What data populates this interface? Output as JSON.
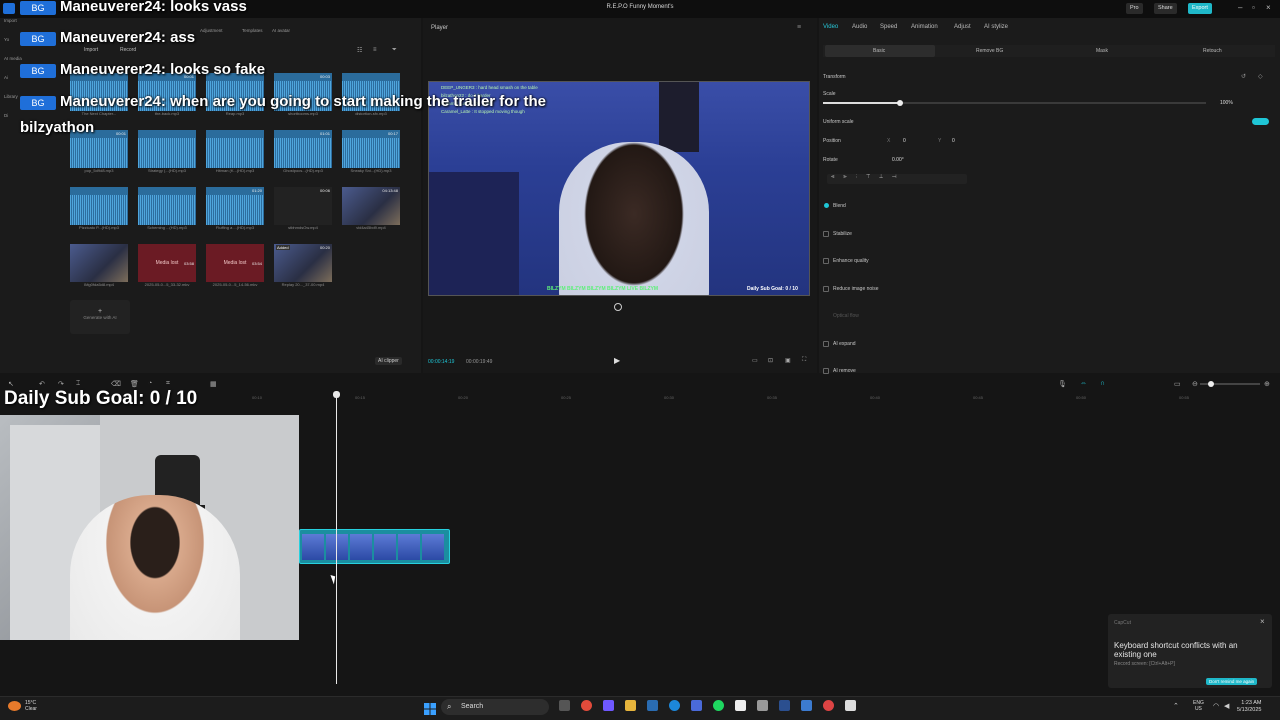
{
  "window": {
    "title": "R.E.P.O Funny Moment's",
    "pro_label": "Pro",
    "share_label": "Share",
    "export_label": "Export"
  },
  "chat_overlay": [
    {
      "user": "Maneuverer24",
      "message": ": looks vass"
    },
    {
      "user": "Maneuverer24",
      "message": ": ass"
    },
    {
      "user": "Maneuverer24",
      "message": ": looks so fake"
    },
    {
      "user": "Maneuverer24",
      "message": ": when are you going to start making the trailer for the"
    },
    {
      "continuation": "bilzyathon"
    }
  ],
  "media": {
    "rail": [
      "Import",
      "Yo",
      "AI media",
      "Ai",
      "Library",
      "Di"
    ],
    "import_label": "Import",
    "record_label": "Record",
    "top_tabs": [
      "Adjustment",
      "Templates",
      "AI avatar"
    ],
    "items": [
      {
        "name": "The Next Chapter...",
        "kind": "wave",
        "duration": ""
      },
      {
        "name": "the-back.mp3",
        "kind": "wave",
        "duration": "00:01"
      },
      {
        "name": "Reap.mp3",
        "kind": "wave",
        "duration": ""
      },
      {
        "name": "shortbooms.mp3",
        "kind": "wave",
        "duration": "00:03"
      },
      {
        "name": "distortion-sfx.mp3",
        "kind": "wave",
        "duration": ""
      },
      {
        "name": "pop_5d9d8.mp3",
        "kind": "wave",
        "duration": "00:01"
      },
      {
        "name": "Strategy (...(HD).mp3",
        "kind": "wave",
        "duration": ""
      },
      {
        "name": "Hitman (K...(HD).mp3",
        "kind": "wave",
        "duration": ""
      },
      {
        "name": "Ghostpocs...(HD).mp3",
        "kind": "wave",
        "duration": "01:01"
      },
      {
        "name": "Sneaky Sni...(HD).mp3",
        "kind": "wave",
        "duration": "00:17"
      },
      {
        "name": "Pizzicato P...(HD).mp3",
        "kind": "wave",
        "duration": ""
      },
      {
        "name": "Scheming ...(HD).mp3",
        "kind": "wave",
        "duration": ""
      },
      {
        "name": "Fluffing a ...(HD).mp3",
        "kind": "wave",
        "duration": "01:20"
      },
      {
        "name": "stbhmdsOw.mp4",
        "kind": "dark",
        "duration": "00:06"
      },
      {
        "name": "vid4a45bd9.mp4",
        "kind": "photo",
        "duration": "04:13:48"
      },
      {
        "name": "IMg0fda5d8.mp4",
        "kind": "photo",
        "duration": ""
      },
      {
        "name": "2025-05-0...5_33-32.mkv",
        "kind": "red",
        "duration": "03:58",
        "lost_label": "Media lost"
      },
      {
        "name": "2025-05-0...5_14-56.mkv",
        "kind": "red",
        "duration": "03:54",
        "lost_label": "Media lost"
      },
      {
        "name": "Replay 20..._37-00.mp4",
        "kind": "photo",
        "duration": "00:20",
        "badge": "Added"
      }
    ],
    "generate_label": "Generate with AI",
    "ai_clipper_label": "AI clipper"
  },
  "player": {
    "label": "Player",
    "current_time": "00:00:14:19",
    "total_time": "00:00:19:49",
    "video_chat": [
      "DEEP_UNGER3 : hard head smash on the table",
      "bilzathon22 : do it harder",
      "Caramel_Latte : Oh yeah",
      "Caramel_Latte : It stopped moving though"
    ],
    "video_banner": "BILZYM  BILZYM  BILZYM  BILZYM LIVE  BILZYM",
    "video_goal": "Daily Sub Goal:  0 / 10"
  },
  "inspector": {
    "tabs": [
      "Video",
      "Audio",
      "Speed",
      "Animation",
      "Adjust",
      "AI stylize"
    ],
    "active_tab": "Video",
    "subtabs": [
      "Basic",
      "Remove BG",
      "Mask",
      "Retouch"
    ],
    "transform_label": "Transform",
    "scale_label": "Scale",
    "scale_value": "100%",
    "scale_fraction": 0.2,
    "uniform_scale_label": "Uniform scale",
    "position_label": "Position",
    "pos_x_label": "X",
    "pos_x": "0",
    "pos_y_label": "Y",
    "pos_y": "0",
    "rotate_label": "Rotate",
    "rotate_value": "0.00°",
    "sections": [
      "Blend",
      "Stabilize",
      "Enhance quality",
      "Reduce image noise",
      "Optical flow",
      "AI expand",
      "AI remove"
    ],
    "accent": "#1fc6d6"
  },
  "timeline": {
    "ruler": [
      "00:10",
      "00:15",
      "00:20",
      "00:25",
      "00:30",
      "00:35",
      "00:40",
      "00:45",
      "00:50",
      "00:55"
    ],
    "sub_goal_overlay": "Daily Sub Goal:  0 / 10"
  },
  "toast": {
    "title": "CapCut",
    "message": "Keyboard shortcut conflicts with an existing one",
    "sub": "Record screen: [Ctrl+Alt+P]",
    "button": "Don't remind me again"
  },
  "taskbar": {
    "weather_temp": "15°C",
    "weather_desc": "Clear",
    "search_label": "Search",
    "lang_1": "ENG",
    "lang_2": "US",
    "time": "1:23 AM",
    "date": "5/13/2025"
  }
}
